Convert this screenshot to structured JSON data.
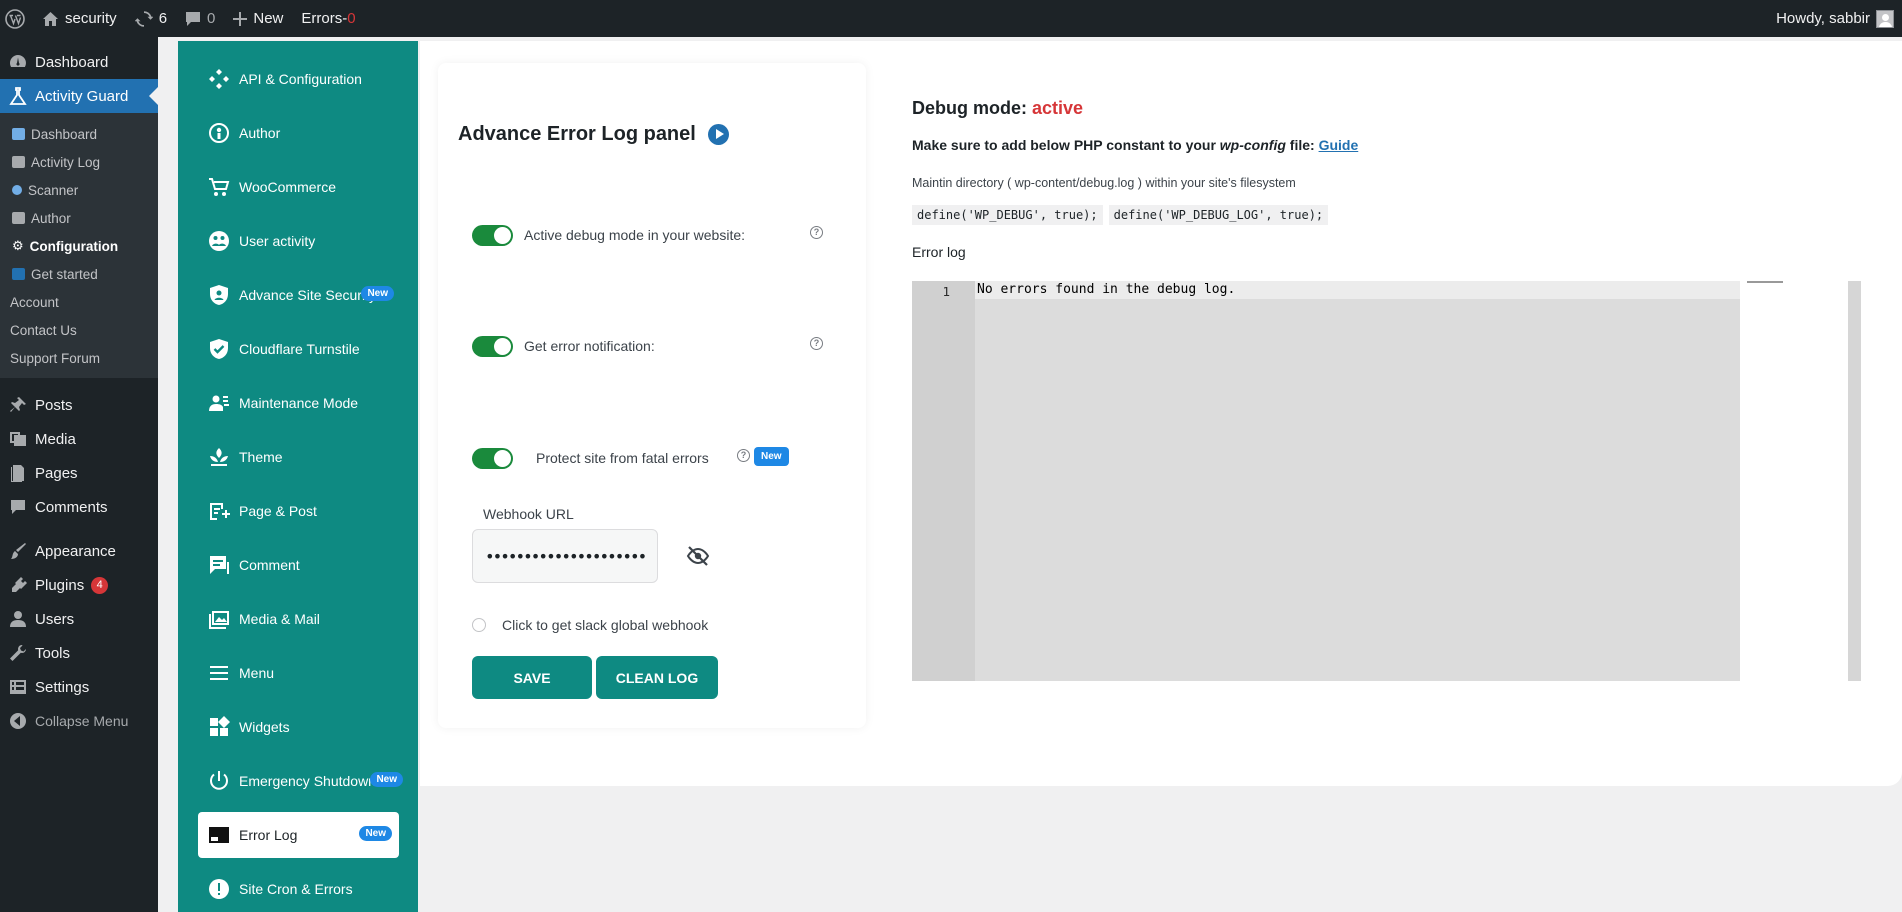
{
  "adminbar": {
    "site_name": "security",
    "updates_count": "6",
    "comments_count": "0",
    "new_label": "New",
    "errors_label": "Errors-",
    "errors_count": "0",
    "howdy": "Howdy, sabbir"
  },
  "sidebar": {
    "dashboard": "Dashboard",
    "activity_guard": "Activity Guard",
    "submenu": [
      {
        "label": "Dashboard",
        "color": "#72aee6"
      },
      {
        "label": "Activity Log",
        "color": "#a7aaad"
      },
      {
        "label": "Scanner",
        "color": "#72aee6"
      },
      {
        "label": "Author",
        "color": "#a7aaad"
      },
      {
        "label": "Configuration",
        "color": "#ffffff"
      },
      {
        "label": "Get started",
        "color": "#2271b1"
      },
      {
        "label": "Account"
      },
      {
        "label": "Contact Us"
      },
      {
        "label": "Support Forum"
      }
    ],
    "items": [
      {
        "label": "Posts",
        "icon": "pin-icon"
      },
      {
        "label": "Media",
        "icon": "media-icon"
      },
      {
        "label": "Pages",
        "icon": "pages-icon"
      },
      {
        "label": "Comments",
        "icon": "comments-icon"
      },
      {
        "label": "Appearance",
        "icon": "brush-icon"
      },
      {
        "label": "Plugins",
        "icon": "plugin-icon",
        "badge": "4"
      },
      {
        "label": "Users",
        "icon": "user-icon"
      },
      {
        "label": "Tools",
        "icon": "wrench-icon"
      },
      {
        "label": "Settings",
        "icon": "settings-icon"
      }
    ],
    "collapse": "Collapse Menu"
  },
  "plugin_nav": {
    "new_badge": "New",
    "items": [
      {
        "label": "API & Configuration"
      },
      {
        "label": "Author"
      },
      {
        "label": "WooCommerce"
      },
      {
        "label": "User activity"
      },
      {
        "label": "Advance Site Security",
        "badge": "New"
      },
      {
        "label": "Cloudflare Turnstile"
      },
      {
        "label": "Maintenance Mode"
      },
      {
        "label": "Theme"
      },
      {
        "label": "Page & Post"
      },
      {
        "label": "Comment"
      },
      {
        "label": "Media & Mail"
      },
      {
        "label": "Menu"
      },
      {
        "label": "Widgets"
      },
      {
        "label": "Emergency Shutdown",
        "badge": "New"
      },
      {
        "label": "Error Log",
        "badge": "New",
        "active": true
      },
      {
        "label": "Site Cron & Errors"
      }
    ]
  },
  "panel": {
    "title": "Advance Error Log panel",
    "toggle_debug": "Active debug mode in your website:",
    "toggle_notify": "Get error notification:",
    "toggle_protect": "Protect site from fatal errors",
    "new_badge": "New",
    "help_glyph": "?",
    "webhook_label": "Webhook URL",
    "webhook_value": "••••••••••••••••••••••••••••••",
    "radio_label": "Click to get slack global webhook",
    "save": "SAVE",
    "clean": "CLEAN LOG"
  },
  "debug": {
    "title_prefix": "Debug mode: ",
    "status": "active",
    "make_sure_pre": "Make sure to add below PHP constant to your ",
    "make_sure_file": "wp-config",
    "make_sure_post": " file: ",
    "guide": "Guide",
    "maintin": "Maintin directory ( wp-content/debug.log ) within your site's filesystem",
    "code1": "define('WP_DEBUG', true);",
    "code2": "define('WP_DEBUG_LOG', true);",
    "error_log_label": "Error log",
    "line_number": "1",
    "log_line": "No errors found in the debug log."
  },
  "colors": {
    "teal": "#0e8a82",
    "wp_dark": "#1d2327",
    "wp_blue": "#2271b1",
    "active_red": "#d63638",
    "toggle_green": "#1a8a3c",
    "new_badge_blue": "#1e88e5"
  }
}
